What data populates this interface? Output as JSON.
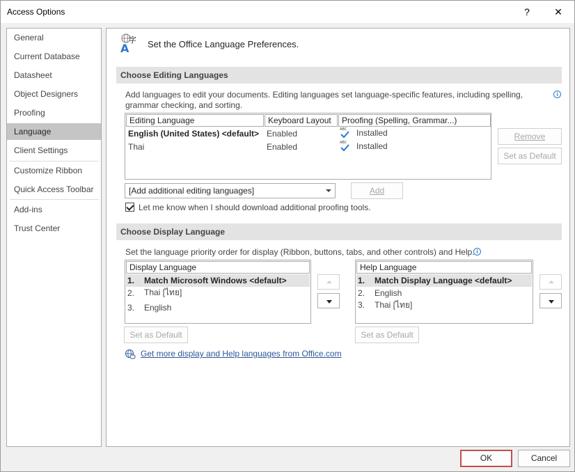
{
  "window": {
    "title": "Access Options",
    "help_glyph": "?",
    "close_glyph": "✕"
  },
  "nav": {
    "items": [
      {
        "label": "General"
      },
      {
        "label": "Current Database"
      },
      {
        "label": "Datasheet"
      },
      {
        "label": "Object Designers"
      },
      {
        "label": "Proofing"
      },
      {
        "label": "Language",
        "selected": true
      },
      {
        "label": "Client Settings"
      },
      {
        "label": "Customize Ribbon"
      },
      {
        "label": "Quick Access Toolbar"
      },
      {
        "label": "Add-ins"
      },
      {
        "label": "Trust Center"
      }
    ]
  },
  "header": {
    "title": "Set the Office Language Preferences.",
    "icon": "language-icon"
  },
  "editing": {
    "heading": "Choose Editing Languages",
    "description_line1": "Add languages to edit your documents. Editing languages set language-specific features, including spelling,",
    "description_line2": "grammar checking, and sorting.",
    "columns": [
      "Editing Language",
      "Keyboard Layout",
      "Proofing (Spelling, Grammar...)"
    ],
    "rows": [
      {
        "language": "English (United States) <default>",
        "keyboard": "Enabled",
        "proofing": "Installed",
        "bold": true
      },
      {
        "language": "Thai",
        "keyboard": "Enabled",
        "proofing": "Installed",
        "bold": false
      }
    ],
    "abc_label": "ABC",
    "remove_label": "Remove",
    "set_default_label": "Set as Default",
    "add_combo_value": "[Add additional editing languages]",
    "add_label": "Add",
    "checkbox_label": "Let me know when I should download additional proofing tools.",
    "checkbox_checked": true
  },
  "display": {
    "heading": "Choose Display Language",
    "description": "Set the language priority order for display (Ribbon, buttons, tabs, and other controls) and Help.",
    "display_column": "Display Language",
    "display_items": [
      {
        "num": "1.",
        "label": "Match Microsoft Windows <default>"
      },
      {
        "num": "2.",
        "label": "Thai [ไทย]"
      },
      {
        "num": "3.",
        "label": "English"
      }
    ],
    "help_column": "Help Language",
    "help_items": [
      {
        "num": "1.",
        "label": "Match Display Language <default>"
      },
      {
        "num": "2.",
        "label": "English"
      },
      {
        "num": "3.",
        "label": "Thai [ไทย]"
      }
    ],
    "set_default_label": "Set as Default",
    "link_label": "Get more display and Help languages from Office.com"
  },
  "footer": {
    "ok_label": "OK",
    "cancel_label": "Cancel"
  },
  "colors": {
    "accent_ok_border": "#c0504d",
    "link": "#2b579a",
    "selection": "#c5c5c5"
  }
}
